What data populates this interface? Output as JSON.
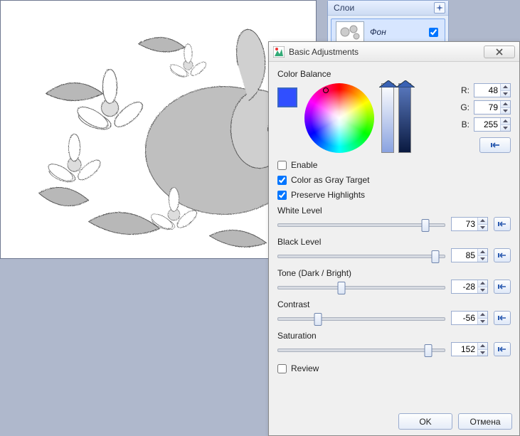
{
  "layers": {
    "title": "Слои",
    "items": [
      {
        "name": "Фон",
        "visible": true
      }
    ]
  },
  "dialog": {
    "title": "Basic Adjustments",
    "section_color_balance": "Color Balance",
    "rgb": {
      "r_label": "R:",
      "g_label": "G:",
      "b_label": "B:",
      "r": "48",
      "g": "79",
      "b": "255"
    },
    "swatch_color": "#304fff",
    "enable": {
      "label": "Enable",
      "checked": false
    },
    "gray_target": {
      "label": "Color as Gray Target",
      "checked": true
    },
    "preserve_highlights": {
      "label": "Preserve Highlights",
      "checked": true
    },
    "white_level": {
      "label": "White Level",
      "value": "73",
      "pos": 88
    },
    "black_level": {
      "label": "Black Level",
      "value": "85",
      "pos": 94
    },
    "tone": {
      "label": "Tone (Dark / Bright)",
      "value": "-28",
      "pos": 38
    },
    "contrast": {
      "label": "Contrast",
      "value": "-56",
      "pos": 24
    },
    "saturation": {
      "label": "Saturation",
      "value": "152",
      "pos": 90
    },
    "review": {
      "label": "Review",
      "checked": false
    },
    "ok": "OK",
    "cancel": "Отмена"
  }
}
